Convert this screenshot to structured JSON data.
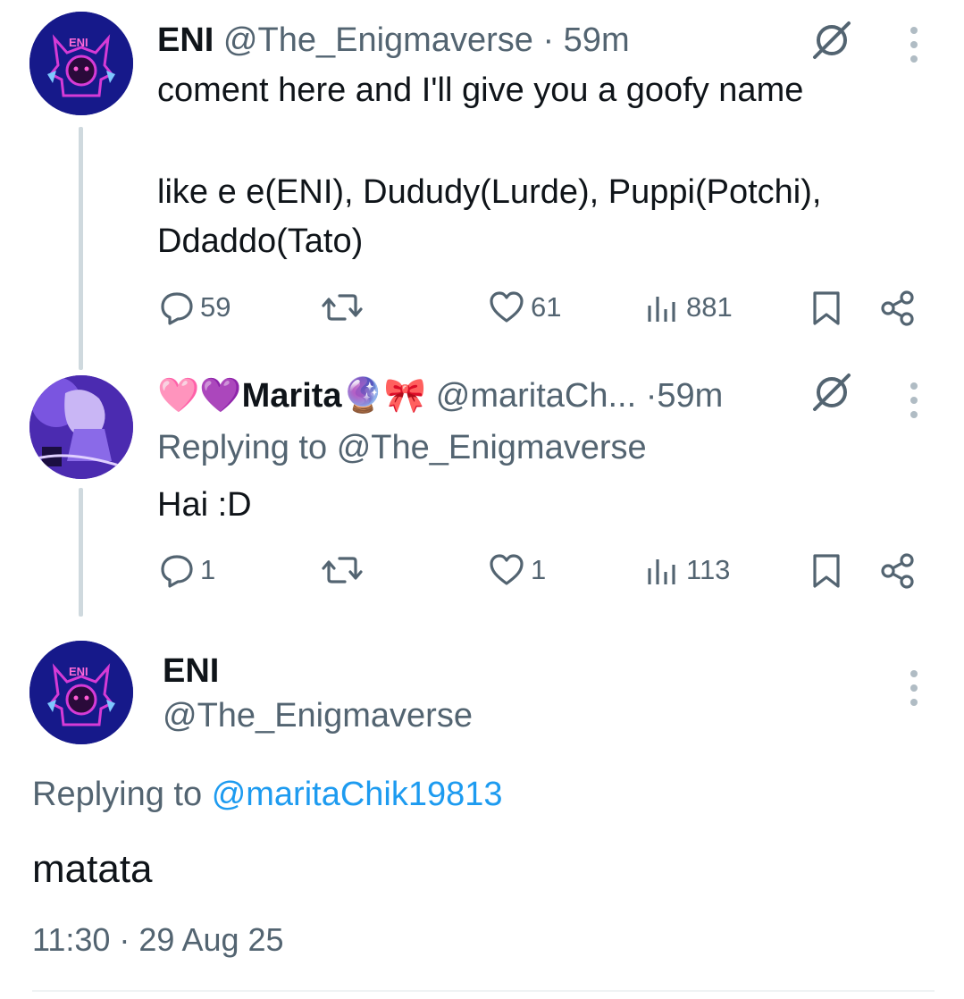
{
  "tweet1": {
    "name": "ENI",
    "handle": "@The_Enigmaverse",
    "separator": "·",
    "time": "59m",
    "text_line1": "coment here and I'll give you a goofy name",
    "text_line2": "like e e(ENI), Dududy(Lurde), Puppi(Potchi),",
    "text_line3": "Ddaddo(Tato)",
    "replies": "59",
    "likes": "61",
    "views": "881",
    "avatar_text": "ENI"
  },
  "tweet2": {
    "name_prefix_emoji": "🩷💜",
    "name": "Marita",
    "name_suffix_emoji": "🔮🎀",
    "handle": "@maritaCh...",
    "separator": "·",
    "time": "59m",
    "replying_prefix": "Replying to",
    "replying_handle": "@The_Enigmaverse",
    "text": "Hai :D",
    "replies": "1",
    "likes": "1",
    "views": "113"
  },
  "tweet3": {
    "name": "ENI",
    "handle": "@The_Enigmaverse",
    "replying_prefix": "Replying to",
    "replying_handle": "@maritaChik19813",
    "text": "matata",
    "timestamp": "11:30 · 29 Aug 25",
    "avatar_text": "ENI"
  },
  "colors": {
    "text": "#0f1419",
    "muted": "#536471",
    "link": "#1d9bf0",
    "thread_line": "#cfd9de",
    "avatar_bg": "#1a1f8c",
    "avatar_art": "#d63bd6"
  }
}
